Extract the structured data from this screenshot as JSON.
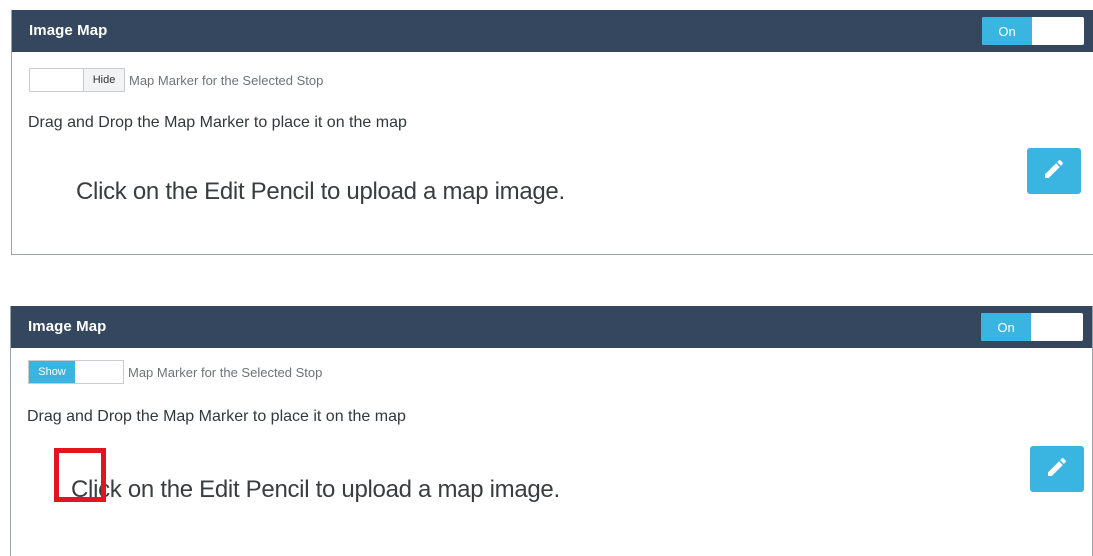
{
  "panels": [
    {
      "header": {
        "title": "Image Map",
        "switch_label": "On"
      },
      "marker_toggle": {
        "state_label": "Hide",
        "caption": "Map Marker for the Selected Stop"
      },
      "instruction": "Drag and Drop the Map Marker to place it on the map",
      "placeholder": "Click on the Edit Pencil  to upload a map image.",
      "edit_icon": "pencil-icon"
    },
    {
      "header": {
        "title": "Image Map",
        "switch_label": "On"
      },
      "marker_toggle": {
        "state_label": "Show",
        "caption": "Map Marker for the Selected Stop"
      },
      "instruction": "Drag and Drop the Map Marker to place it on the map",
      "placeholder": "Click on the Edit Pencil  to upload a map image.",
      "edit_icon": "pencil-icon",
      "map_marker": "red-square-marker"
    }
  ],
  "colors": {
    "header_bg": "#34475f",
    "accent": "#3ab4e0",
    "marker": "#e0151f"
  }
}
